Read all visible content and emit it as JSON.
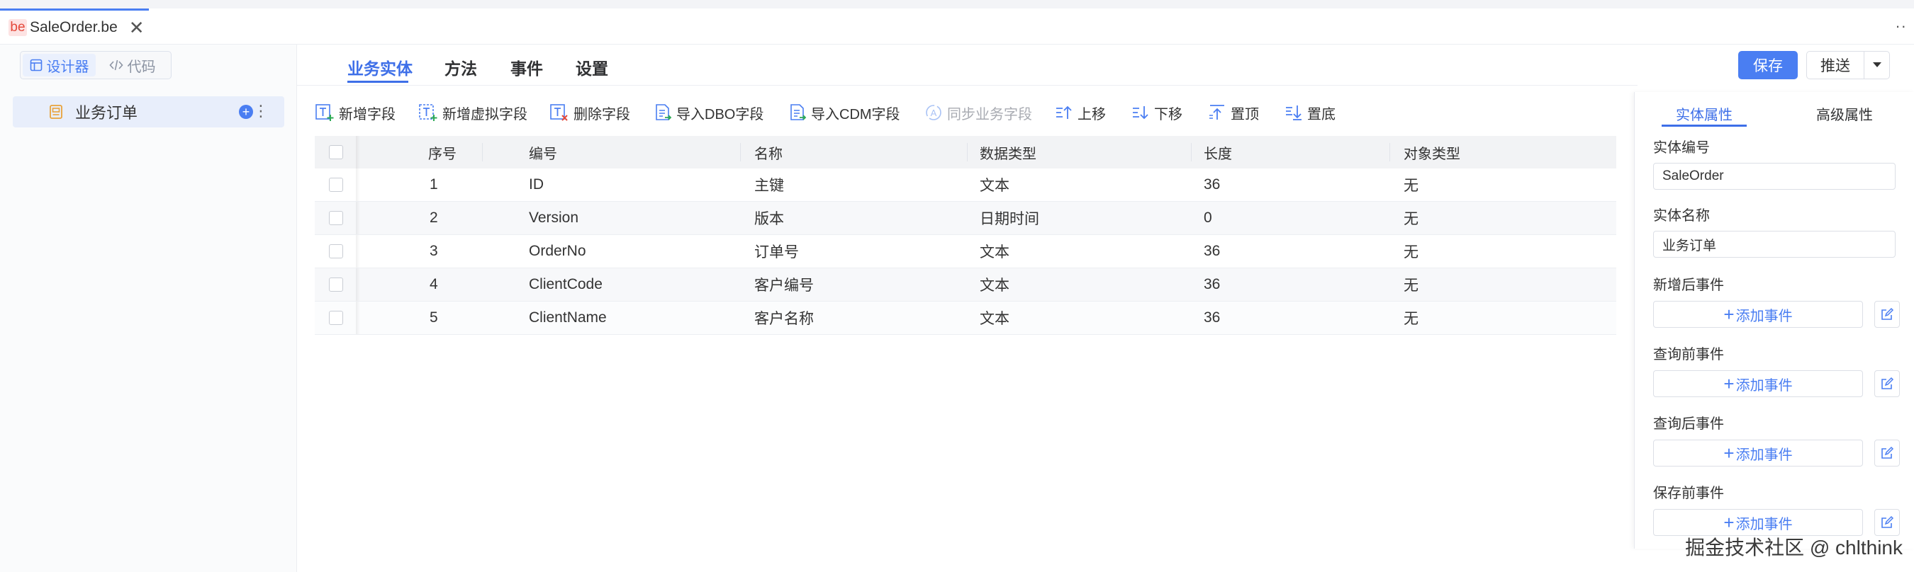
{
  "file_tab": {
    "badge": "be",
    "name": "SaleOrder.be",
    "close": "✕"
  },
  "more": "⋮",
  "view_switch": {
    "designer": "设计器",
    "code": "代码"
  },
  "tree": {
    "item_label": "业务订单",
    "add": "+",
    "menu": "⋮"
  },
  "nav_tabs": [
    "业务实体",
    "方法",
    "事件",
    "设置"
  ],
  "actions": {
    "save": "保存",
    "push": "推送"
  },
  "toolbar": {
    "add_field": "新增字段",
    "add_virtual_field": "新增虚拟字段",
    "delete_field": "删除字段",
    "import_dbo": "导入DBO字段",
    "import_cdm": "导入CDM字段",
    "sync_business": "同步业务字段",
    "move_up": "上移",
    "move_down": "下移",
    "move_top": "置顶",
    "move_bottom": "置底"
  },
  "grid": {
    "columns": [
      "序号",
      "编号",
      "名称",
      "数据类型",
      "长度",
      "对象类型"
    ],
    "rows": [
      [
        "1",
        "ID",
        "主键",
        "文本",
        "36",
        "无"
      ],
      [
        "2",
        "Version",
        "版本",
        "日期时间",
        "0",
        "无"
      ],
      [
        "3",
        "OrderNo",
        "订单号",
        "文本",
        "36",
        "无"
      ],
      [
        "4",
        "ClientCode",
        "客户编号",
        "文本",
        "36",
        "无"
      ],
      [
        "5",
        "ClientName",
        "客户名称",
        "文本",
        "36",
        "无"
      ]
    ]
  },
  "right_panel": {
    "tabs": [
      "实体属性",
      "高级属性"
    ],
    "entity_code_label": "实体编号",
    "entity_code_value": "SaleOrder",
    "entity_name_label": "实体名称",
    "entity_name_value": "业务订单",
    "add_event_text": "添加事件",
    "events": [
      "新增后事件",
      "查询前事件",
      "查询后事件",
      "保存前事件"
    ]
  },
  "watermark": "掘金技术社区 @ chlthink",
  "colors": {
    "accent": "#4a7ef2",
    "active_text": "#3e6fe8"
  }
}
